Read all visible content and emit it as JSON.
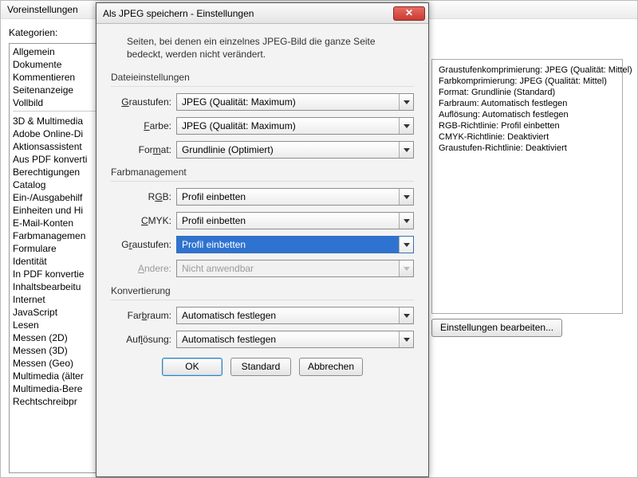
{
  "prefs": {
    "title": "Voreinstellungen",
    "kat_label": "Kategorien:",
    "items_top": [
      "Allgemein",
      "Dokumente",
      "Kommentieren",
      "Seitenanzeige",
      "Vollbild"
    ],
    "items_bottom": [
      "3D & Multimedia",
      "Adobe Online-Di",
      "Aktionsassistent",
      "Aus PDF konverti",
      "Berechtigungen",
      "Catalog",
      "Ein-/Ausgabehilf",
      "Einheiten und Hi",
      "E-Mail-Konten",
      "Farbmanagemen",
      "Formulare",
      "Identität",
      "In PDF konvertie",
      "Inhaltsbearbeitu",
      "Internet",
      "JavaScript",
      "Lesen",
      "Messen (2D)",
      "Messen (3D)",
      "Messen (Geo)",
      "Multimedia (älter",
      "Multimedia-Bere",
      "Rechtschreibpr"
    ]
  },
  "summary": {
    "lines": [
      "Graustufenkomprimierung: JPEG (Qualität: Mittel)",
      "Farbkomprimierung: JPEG (Qualität: Mittel)",
      "Format: Grundlinie (Standard)",
      "Farbraum: Automatisch festlegen",
      "Auflösung: Automatisch festlegen",
      "RGB-Richtlinie: Profil einbetten",
      "CMYK-Richtlinie: Deaktiviert",
      "Graustufen-Richtlinie: Deaktiviert"
    ],
    "edit_btn": "Einstellungen bearbeiten..."
  },
  "dialog": {
    "title": "Als JPEG speichern - Einstellungen",
    "intro": "Seiten, bei denen ein einzelnes JPEG-Bild die ganze Seite bedeckt, werden nicht verändert.",
    "file_group": "Dateieinstellungen",
    "graustufen_label": "Graustufen:",
    "graustufen_value": "JPEG (Qualität: Maximum)",
    "farbe_label": "Farbe:",
    "farbe_value": "JPEG (Qualität: Maximum)",
    "format_label": "Format:",
    "format_value": "Grundlinie (Optimiert)",
    "color_group": "Farbmanagement",
    "rgb_label": "RGB:",
    "rgb_value": "Profil einbetten",
    "cmyk_label": "CMYK:",
    "cmyk_value": "Profil einbetten",
    "gs2_label": "Graustufen:",
    "gs2_value": "Profil einbetten",
    "andere_label": "Andere:",
    "andere_value": "Nicht anwendbar",
    "conv_group": "Konvertierung",
    "farbraum_label": "Farbraum:",
    "farbraum_value": "Automatisch festlegen",
    "aufloesung_label": "Auflösung:",
    "aufloesung_value": "Automatisch festlegen",
    "ok": "OK",
    "standard": "Standard",
    "abbrechen": "Abbrechen"
  }
}
